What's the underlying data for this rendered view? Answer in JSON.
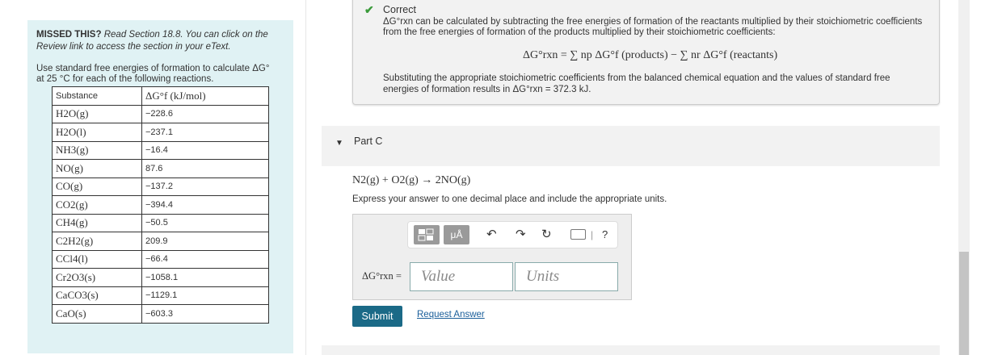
{
  "left_panel": {
    "missed_bold": "MISSED THIS?",
    "missed_text": "Read Section 18.8. You can click on the Review link to access the section in your eText.",
    "instruction_line1": "Use standard free energies of formation to calculate ΔG°",
    "instruction_line2": "at 25 °C for each of the following reactions.",
    "table": {
      "headers": [
        "Substance",
        "ΔG°f (kJ/mol)"
      ],
      "rows": [
        [
          "H2O(g)",
          "−228.6"
        ],
        [
          "H2O(l)",
          "−237.1"
        ],
        [
          "NH3(g)",
          "−16.4"
        ],
        [
          "NO(g)",
          "87.6"
        ],
        [
          "CO(g)",
          "−137.2"
        ],
        [
          "CO2(g)",
          "−394.4"
        ],
        [
          "CH4(g)",
          "−50.5"
        ],
        [
          "C2H2(g)",
          "209.9"
        ],
        [
          "CCl4(l)",
          "−66.4"
        ],
        [
          "Cr2O3(s)",
          "−1058.1"
        ],
        [
          "CaCO3(s)",
          "−1129.1"
        ],
        [
          "CaO(s)",
          "−603.3"
        ]
      ]
    }
  },
  "feedback": {
    "status": "Correct",
    "explanation1": "ΔG°rxn can be calculated by subtracting the free energies of formation of the reactants multiplied by their stoichiometric coefficients from the free energies of formation of the products multiplied by their stoichiometric coefficients:",
    "formula": "ΔG°rxn = ∑ np ΔG°f (products) − ∑ nr ΔG°f (reactants)",
    "explanation2": "Substituting the appropriate stoichiometric coefficients from the balanced chemical equation and the values of standard free energies of formation results in ΔG°rxn = 372.3 kJ."
  },
  "part_c": {
    "label": "Part C",
    "equation": "N2(g) + O2(g) → 2NO(g)",
    "instruction": "Express your answer to one decimal place and include the appropriate units.",
    "toolbar": {
      "mu_label": "μÅ",
      "undo_icon": "undo-arrow-icon",
      "redo_icon": "redo-arrow-icon",
      "reset_icon": "reset-icon",
      "keyboard_icon": "keyboard-icon",
      "help_label": "?"
    },
    "variable_label": "ΔG°rxn =",
    "value_placeholder": "Value",
    "units_placeholder": "Units",
    "submit_label": "Submit",
    "request_label": "Request Answer"
  },
  "colors": {
    "panel_bg": "#e0f2f4",
    "submit_bg": "#1b6a87",
    "correct_check": "#3a9a3a",
    "link": "#1a5e9a"
  }
}
